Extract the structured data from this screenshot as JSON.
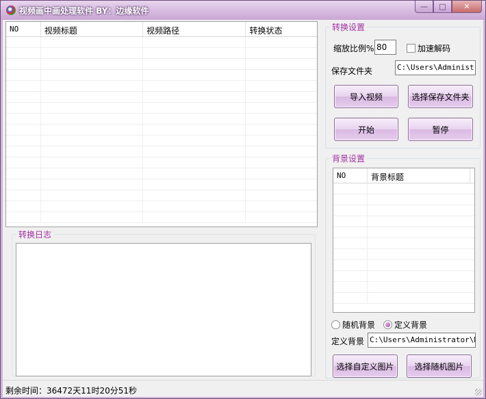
{
  "window": {
    "title": "视频画中画处理软件 BY：边缘软件",
    "minimize_glyph": "—",
    "maximize_glyph": "□",
    "close_glyph": "✕"
  },
  "video_list": {
    "columns": [
      "NO",
      "视频标题",
      "视频路径",
      "转换状态"
    ],
    "rows": []
  },
  "log": {
    "title": "转换日志",
    "content": ""
  },
  "convert_settings": {
    "title": "转换设置",
    "scale_label": "缩放比例%",
    "scale_value": "80",
    "accel_decode_label": "加速解码",
    "accel_decode_checked": false,
    "save_folder_label": "保存文件夹",
    "save_folder_value": "C:\\Users\\Administrator\\D",
    "import_button": "导入视频",
    "choose_folder_button": "选择保存文件夹",
    "start_button": "开始",
    "pause_button": "暂停"
  },
  "background_settings": {
    "title": "背景设置",
    "columns": [
      "NO",
      "背景标题"
    ],
    "rows": [],
    "random_bg_label": "随机背景",
    "custom_bg_label": "定义背景",
    "selected_mode": "custom",
    "custom_bg_path_label": "定义背景",
    "custom_bg_path_value": "C:\\Users\\Administrator\\Des",
    "choose_custom_image_button": "选择自定义图片",
    "choose_random_image_button": "选择随机图片"
  },
  "status_bar": {
    "text": "剩余时间：36472天11时20分51秒"
  },
  "colors": {
    "frame": "#d1b3d9",
    "group_title": "#a030a0",
    "button_top": "#f8eefb",
    "button_bottom": "#d9b9e2"
  }
}
